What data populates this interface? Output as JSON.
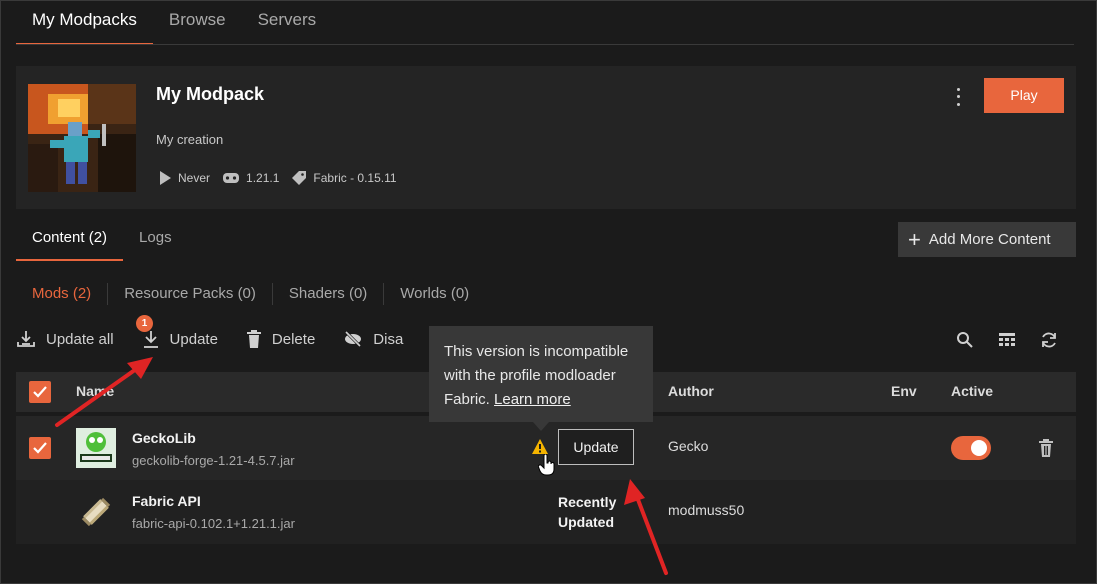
{
  "top_tabs": [
    "My Modpacks",
    "Browse",
    "Servers"
  ],
  "pack": {
    "title": "My Modpack",
    "description": "My creation",
    "last_played": "Never",
    "game_version": "1.21.1",
    "loader": "Fabric - 0.15.11",
    "play_label": "Play"
  },
  "content_tabs": [
    "Content (2)",
    "Logs"
  ],
  "add_content_label": "Add More Content",
  "filters": [
    "Mods (2)",
    "Resource Packs (0)",
    "Shaders (0)",
    "Worlds (0)"
  ],
  "toolbar": {
    "update_all": "Update all",
    "update": "Update",
    "update_badge": "1",
    "delete": "Delete",
    "disable": "Disa"
  },
  "table": {
    "col_name": "Name",
    "col_author": "Author",
    "col_env": "Env",
    "col_active": "Active"
  },
  "rows": [
    {
      "name": "GeckoLib",
      "file": "geckolib-forge-1.21-4.5.7.jar",
      "action": "Update",
      "author": "Gecko"
    },
    {
      "name": "Fabric API",
      "file": "fabric-api-0.102.1+1.21.1.jar",
      "status_line1": "Recently",
      "status_line2": "Updated",
      "author": "modmuss50"
    }
  ],
  "tooltip": {
    "line1": "This version is incompatible",
    "line2": "with the profile modloader",
    "line3": "Fabric.",
    "link": "Learn more"
  },
  "colors": {
    "accent": "#e8663d",
    "background": "#1b1b1b",
    "arrow": "#e02424",
    "warning": "#f5b400"
  }
}
